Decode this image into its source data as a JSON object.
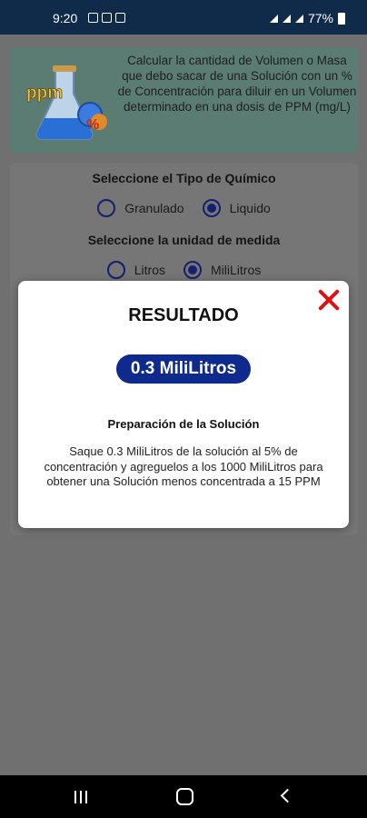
{
  "status_bar": {
    "time": "9:20",
    "battery": "77%",
    "notification_icons": [
      "gallery-icon",
      "message-icon",
      "message-icon"
    ],
    "system_icons": [
      "wifi-icon",
      "signal-icon",
      "signal-icon",
      "battery-icon"
    ]
  },
  "header": {
    "logo_text": "ppm",
    "description": "Calcular la cantidad de Volumen o Masa que debo sacar de una Solución con un % de Concentración para diluir en un Volumen determinado en una dosis de PPM (mg/L)"
  },
  "form": {
    "chemical_type_label": "Seleccione el Tipo de Químico",
    "chemical_types": [
      {
        "label": "Granulado",
        "checked": false
      },
      {
        "label": "Liquido",
        "checked": true
      }
    ],
    "unit_label": "Seleccione la unidad de medida",
    "units": [
      {
        "label": "Litros",
        "checked": false
      },
      {
        "label": "MiliLitros",
        "checked": true
      }
    ]
  },
  "dialog": {
    "title": "RESULTADO",
    "result": "0.3 MiliLitros",
    "prep_title": "Preparación de la Solución",
    "prep_text": "Saque 0.3 MiliLitros de la solución al 5% de concentración y agreguelos a los 1000 MiliLitros para obtener una Solución menos concentrada a 15 PPM"
  },
  "colors": {
    "status_bar": "#102a4a",
    "header_card": "#5a7c72",
    "pill": "#0d2a8c",
    "close": "#dd1111",
    "radio": "#14206e"
  }
}
